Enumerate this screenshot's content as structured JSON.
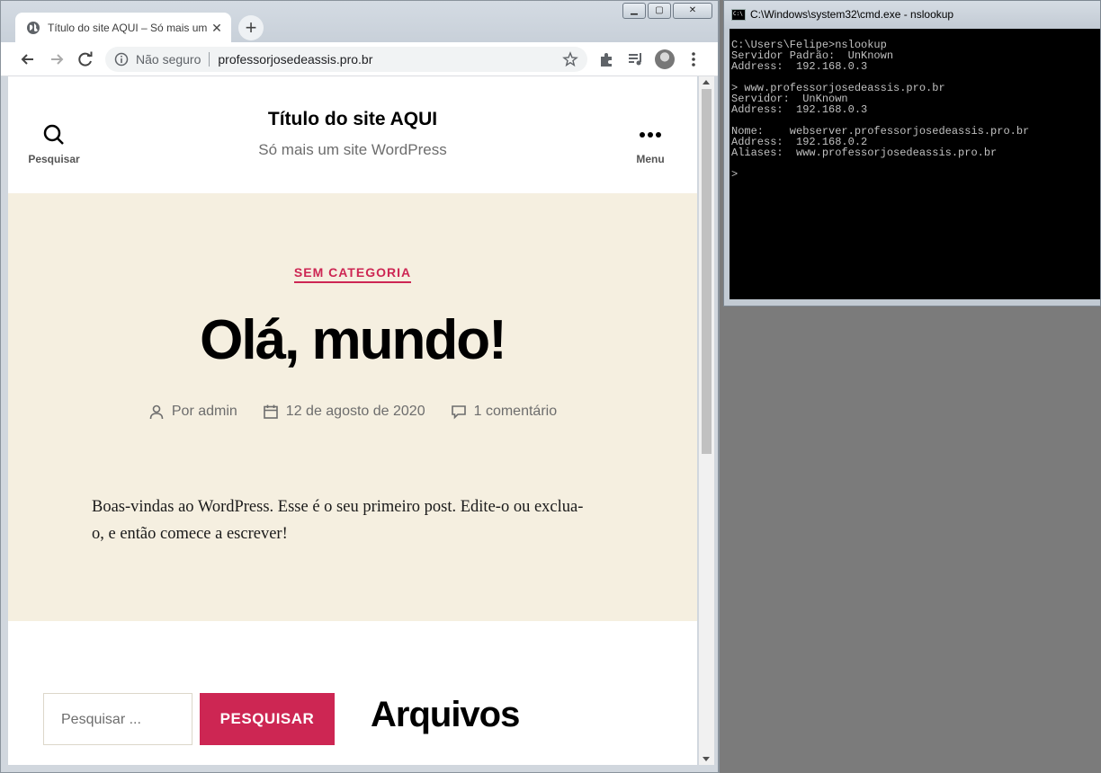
{
  "browser": {
    "tab_title": "Título do site AQUI – Só mais um site WordPress",
    "security_label": "Não seguro",
    "url": "professorjosedeassis.pro.br",
    "new_tab": "+",
    "tab_close": "✕"
  },
  "site": {
    "search_label": "Pesquisar",
    "menu_label": "Menu",
    "title": "Título do site AQUI",
    "description": "Só mais um site WordPress"
  },
  "post": {
    "category": "SEM CATEGORIA",
    "title": "Olá, mundo!",
    "author": "Por admin",
    "date": "12 de agosto de 2020",
    "comments": "1 comentário",
    "body": "Boas-vindas ao WordPress. Esse é o seu primeiro post. Edite-o ou exclua-o, e então comece a escrever!"
  },
  "widgets": {
    "search_placeholder": "Pesquisar ...",
    "search_button": "PESQUISAR",
    "archives_title": "Arquivos"
  },
  "cmd": {
    "title": "C:\\Windows\\system32\\cmd.exe - nslookup",
    "lines": [
      "C:\\Users\\Felipe>nslookup",
      "Servidor Padrão:  UnKnown",
      "Address:  192.168.0.3",
      "",
      "> www.professorjosedeassis.pro.br",
      "Servidor:  UnKnown",
      "Address:  192.168.0.3",
      "",
      "Nome:    webserver.professorjosedeassis.pro.br",
      "Address:  192.168.0.2",
      "Aliases:  www.professorjosedeassis.pro.br",
      "",
      ">"
    ]
  },
  "colors": {
    "accent": "#cd2653",
    "hero_bg": "#f5efe0"
  }
}
